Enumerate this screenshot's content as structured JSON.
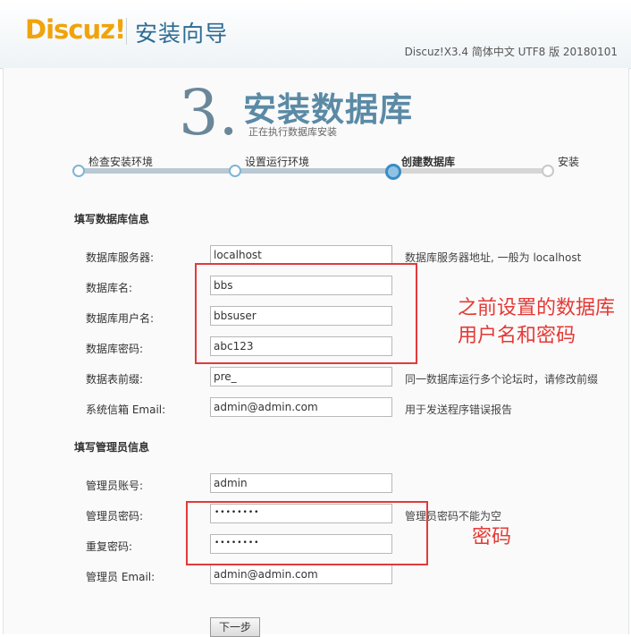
{
  "header": {
    "logo_main": "Discuz",
    "logo_bang": "!",
    "wizard_title": "安装向导",
    "version": "Discuz!X3.4 简体中文 UTF8 版 20180101"
  },
  "step": {
    "number": "3.",
    "title": "安装数据库",
    "subtitle": "正在执行数据库安装",
    "progress_steps": [
      {
        "label": "检查安装环境",
        "state": "done"
      },
      {
        "label": "设置运行环境",
        "state": "done"
      },
      {
        "label": "创建数据库",
        "state": "current"
      },
      {
        "label": "安装",
        "state": "future"
      }
    ]
  },
  "db_section": {
    "title": "填写数据库信息",
    "fields": [
      {
        "label": "数据库服务器:",
        "value": "localhost",
        "hint": "数据库服务器地址, 一般为 localhost"
      },
      {
        "label": "数据库名:",
        "value": "bbs",
        "hint": ""
      },
      {
        "label": "数据库用户名:",
        "value": "bbsuser",
        "hint": ""
      },
      {
        "label": "数据库密码:",
        "value": "abc123",
        "hint": ""
      },
      {
        "label": "数据表前缀:",
        "value": "pre_",
        "hint": "同一数据库运行多个论坛时，请修改前缀"
      },
      {
        "label": "系统信箱 Email:",
        "value": "admin@admin.com",
        "hint": "用于发送程序错误报告"
      }
    ]
  },
  "admin_section": {
    "title": "填写管理员信息",
    "fields": [
      {
        "label": "管理员账号:",
        "value": "admin",
        "hint": ""
      },
      {
        "label": "管理员密码:",
        "value": "••••••••",
        "hint": "管理员密码不能为空"
      },
      {
        "label": "重复密码:",
        "value": "••••••••",
        "hint": ""
      },
      {
        "label": "管理员 Email:",
        "value": "admin@admin.com",
        "hint": ""
      }
    ]
  },
  "annotations": {
    "db_note_line1": "之前设置的数据库",
    "db_note_line2": "用户名和密码",
    "pwd_note": "密码",
    "color": "#e53935"
  },
  "next_button": "下一步",
  "colors": {
    "logo_orange": "#f0a30a",
    "title_blue": "#5b8aa5",
    "progress_blue": "#3b8cc4"
  }
}
